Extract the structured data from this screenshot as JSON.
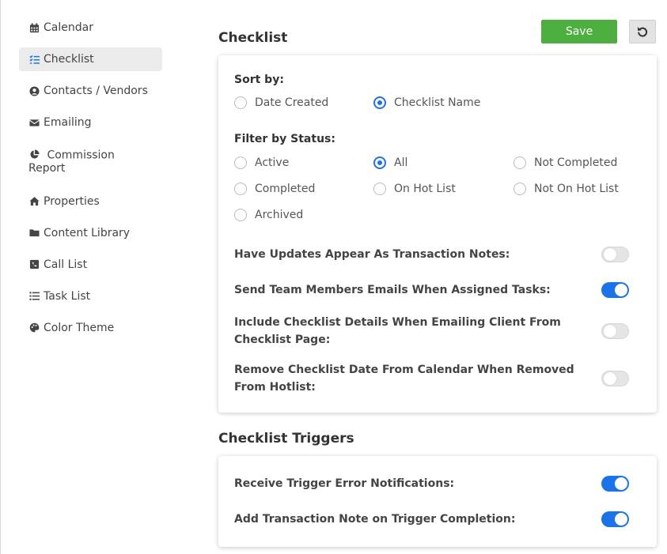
{
  "sidebar": {
    "items": [
      {
        "label": "Calendar",
        "icon": "calendar-icon"
      },
      {
        "label": "Checklist",
        "icon": "checklist-icon",
        "active": true
      },
      {
        "label": "Contacts / Vendors",
        "icon": "user-circle-icon"
      },
      {
        "label": "Emailing",
        "icon": "envelope-icon"
      },
      {
        "label_line1": "Commission",
        "label_line2": "Report",
        "icon": "pie-chart-icon"
      },
      {
        "label": "Properties",
        "icon": "home-icon"
      },
      {
        "label": "Content Library",
        "icon": "folder-icon"
      },
      {
        "label": "Call List",
        "icon": "phone-square-icon"
      },
      {
        "label": "Task List",
        "icon": "list-icon"
      },
      {
        "label": "Color Theme",
        "icon": "palette-icon"
      }
    ]
  },
  "header": {
    "title": "Checklist",
    "save_label": "Save",
    "reset_icon": "undo-icon"
  },
  "checklist": {
    "sort_by_label": "Sort by:",
    "sort_options": [
      {
        "label": "Date Created",
        "checked": false
      },
      {
        "label": "Checklist Name",
        "checked": true
      }
    ],
    "filter_label": "Filter by Status:",
    "filter_options": [
      {
        "label": "Active",
        "checked": false
      },
      {
        "label": "All",
        "checked": true
      },
      {
        "label": "Not Completed",
        "checked": false
      },
      {
        "label": "Completed",
        "checked": false
      },
      {
        "label": "On Hot List",
        "checked": false
      },
      {
        "label": "Not On Hot List",
        "checked": false
      },
      {
        "label": "Archived",
        "checked": false
      }
    ],
    "settings": [
      {
        "label": "Have Updates Appear As Transaction Notes:",
        "on": false
      },
      {
        "label": "Send Team Members Emails When Assigned Tasks:",
        "on": true
      },
      {
        "label_line1": "Include Checklist Details When Emailing Client From",
        "label_line2": "Checklist Page:",
        "on": false
      },
      {
        "label_line1": "Remove Checklist Date From Calendar When Removed",
        "label_line2": "From Hotlist:",
        "on": false
      }
    ]
  },
  "triggers": {
    "title": "Checklist Triggers",
    "settings": [
      {
        "label": "Receive Trigger Error Notifications:",
        "on": true
      },
      {
        "label": "Add Transaction Note on Trigger Completion:",
        "on": true
      }
    ]
  },
  "colors": {
    "accent": "#1a73e8",
    "save": "#4caf3f",
    "active_nav": "#ebebeb"
  }
}
